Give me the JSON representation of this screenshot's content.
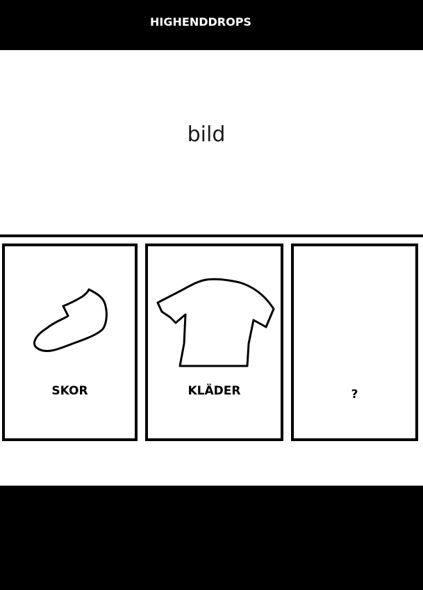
{
  "header": {
    "brand": "HIGHENDDROPS"
  },
  "hero": {
    "text": "bild"
  },
  "categories": [
    {
      "label": "SKOR",
      "icon": "shoe-icon"
    },
    {
      "label": "KLÄDER",
      "icon": "tshirt-icon"
    },
    {
      "label": "?",
      "icon": ""
    }
  ],
  "colors": {
    "header_bg": "#000000",
    "footer_bg": "#000000",
    "page_bg": "#ffffff",
    "header_text": "#ffffff"
  }
}
